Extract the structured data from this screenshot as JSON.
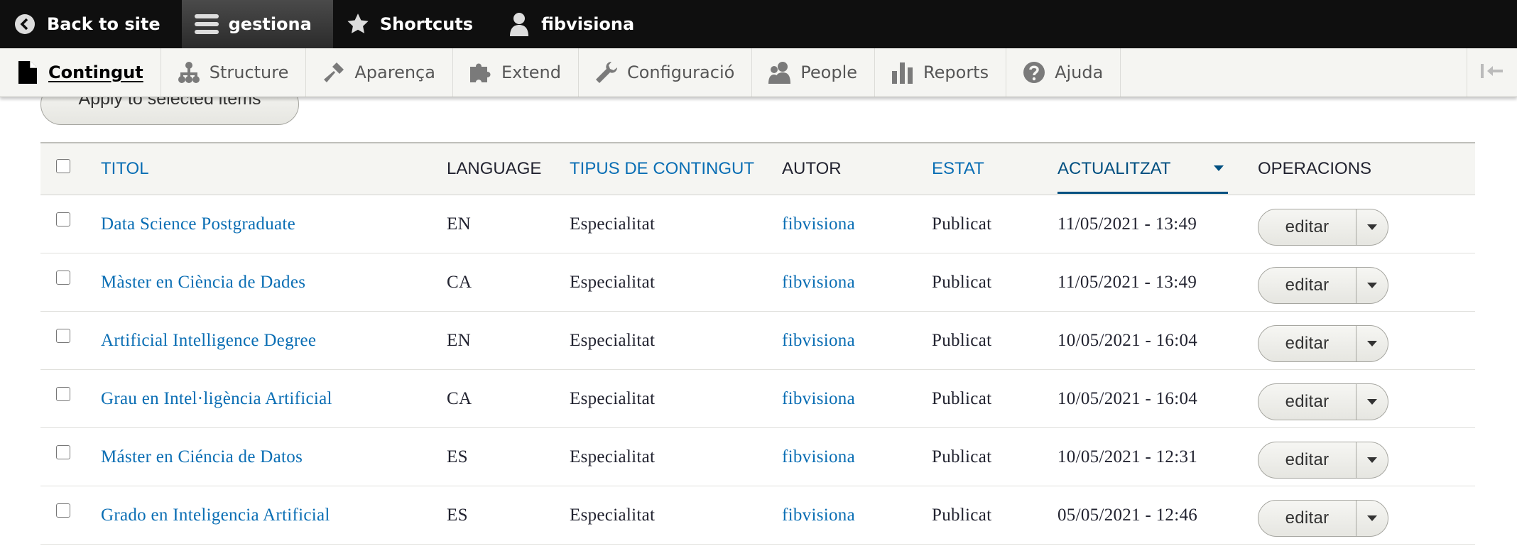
{
  "toolbar": {
    "back": "Back to site",
    "manage": "gestiona",
    "shortcuts": "Shortcuts",
    "user": "fibvisiona"
  },
  "tray": {
    "items": [
      {
        "label": "Contingut",
        "icon": "file-icon"
      },
      {
        "label": "Structure",
        "icon": "sitemap-icon"
      },
      {
        "label": "Aparença",
        "icon": "paintbrush-icon"
      },
      {
        "label": "Extend",
        "icon": "puzzle-icon"
      },
      {
        "label": "Configuració",
        "icon": "wrench-icon"
      },
      {
        "label": "People",
        "icon": "people-icon"
      },
      {
        "label": "Reports",
        "icon": "bar-chart-icon"
      },
      {
        "label": "Ajuda",
        "icon": "help-icon"
      }
    ]
  },
  "bulk": {
    "apply_label": "Apply to selected items"
  },
  "table": {
    "headers": {
      "title": "Titol",
      "language": "Language",
      "type": "Tipus de contingut",
      "author": "Autor",
      "status": "Estat",
      "updated": "Actualitzat",
      "operations": "Operacions"
    },
    "sorted_by": "updated",
    "sort_direction": "desc",
    "rows": [
      {
        "title": "Data Science Postgraduate",
        "language": "EN",
        "type": "Especialitat",
        "author": "fibvisiona",
        "status": "Publicat",
        "updated": "11/05/2021 - 13:49",
        "edit": "editar"
      },
      {
        "title": "Màster en Ciència de Dades",
        "language": "CA",
        "type": "Especialitat",
        "author": "fibvisiona",
        "status": "Publicat",
        "updated": "11/05/2021 - 13:49",
        "edit": "editar"
      },
      {
        "title": "Artificial Intelligence Degree",
        "language": "EN",
        "type": "Especialitat",
        "author": "fibvisiona",
        "status": "Publicat",
        "updated": "10/05/2021 - 16:04",
        "edit": "editar"
      },
      {
        "title": "Grau en Intel·ligència Artificial",
        "language": "CA",
        "type": "Especialitat",
        "author": "fibvisiona",
        "status": "Publicat",
        "updated": "10/05/2021 - 16:04",
        "edit": "editar"
      },
      {
        "title": "Máster en Ciéncia de Datos",
        "language": "ES",
        "type": "Especialitat",
        "author": "fibvisiona",
        "status": "Publicat",
        "updated": "10/05/2021 - 12:31",
        "edit": "editar"
      },
      {
        "title": "Grado en Inteligencia Artificial",
        "language": "ES",
        "type": "Especialitat",
        "author": "fibvisiona",
        "status": "Publicat",
        "updated": "05/05/2021 - 12:46",
        "edit": "editar"
      }
    ]
  },
  "colors": {
    "link": "#0a6eb4",
    "toolbar_bg": "#0f0f0f",
    "tray_bg": "#f5f5f2"
  }
}
